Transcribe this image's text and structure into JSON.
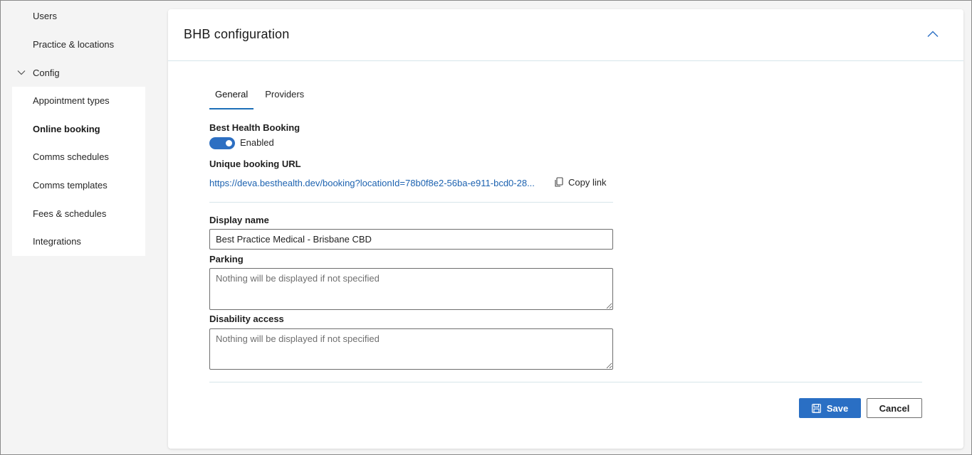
{
  "sidebar": {
    "top_items": [
      {
        "label": "Users"
      },
      {
        "label": "Practice & locations"
      }
    ],
    "group": {
      "label": "Config"
    },
    "sub_items": [
      {
        "label": "Appointment types"
      },
      {
        "label": "Online booking"
      },
      {
        "label": "Comms schedules"
      },
      {
        "label": "Comms templates"
      },
      {
        "label": "Fees & schedules"
      },
      {
        "label": "Integrations"
      }
    ]
  },
  "card": {
    "title": "BHB configuration",
    "tabs": [
      {
        "label": "General"
      },
      {
        "label": "Providers"
      }
    ],
    "booking": {
      "label": "Best Health Booking",
      "toggle_state_label": "Enabled"
    },
    "url": {
      "label": "Unique booking URL",
      "value": "https://deva.besthealth.dev/booking?locationId=78b0f8e2-56ba-e911-bcd0-28...",
      "copy_label": "Copy link"
    },
    "display_name": {
      "label": "Display name",
      "value": "Best Practice Medical - Brisbane CBD"
    },
    "parking": {
      "label": "Parking",
      "placeholder": "Nothing will be displayed if not specified"
    },
    "disability": {
      "label": "Disability access",
      "placeholder": "Nothing will be displayed if not specified"
    },
    "actions": {
      "save_label": "Save",
      "cancel_label": "Cancel"
    }
  },
  "colors": {
    "accent": "#2a6fc4",
    "link": "#1c62b0",
    "divider": "#d7e6ea"
  }
}
